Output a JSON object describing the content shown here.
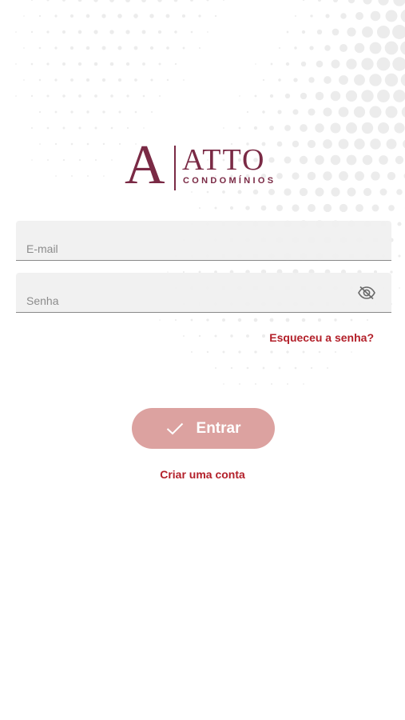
{
  "logo": {
    "letter": "A",
    "name": "ATTO",
    "subtitle": "CONDOMÍNIOS",
    "color": "#7a2a45"
  },
  "form": {
    "email_placeholder": "E-mail",
    "password_placeholder": "Senha",
    "password_toggle_icon": "eye-off-icon",
    "forgot_password_label": "Esqueceu a senha?",
    "login_button_label": "Entrar",
    "login_button_icon": "check-icon",
    "signup_label": "Criar uma conta"
  },
  "colors": {
    "accent": "#b3202a",
    "button_bg": "#dca2a0",
    "field_bg": "#f0f0f0"
  }
}
